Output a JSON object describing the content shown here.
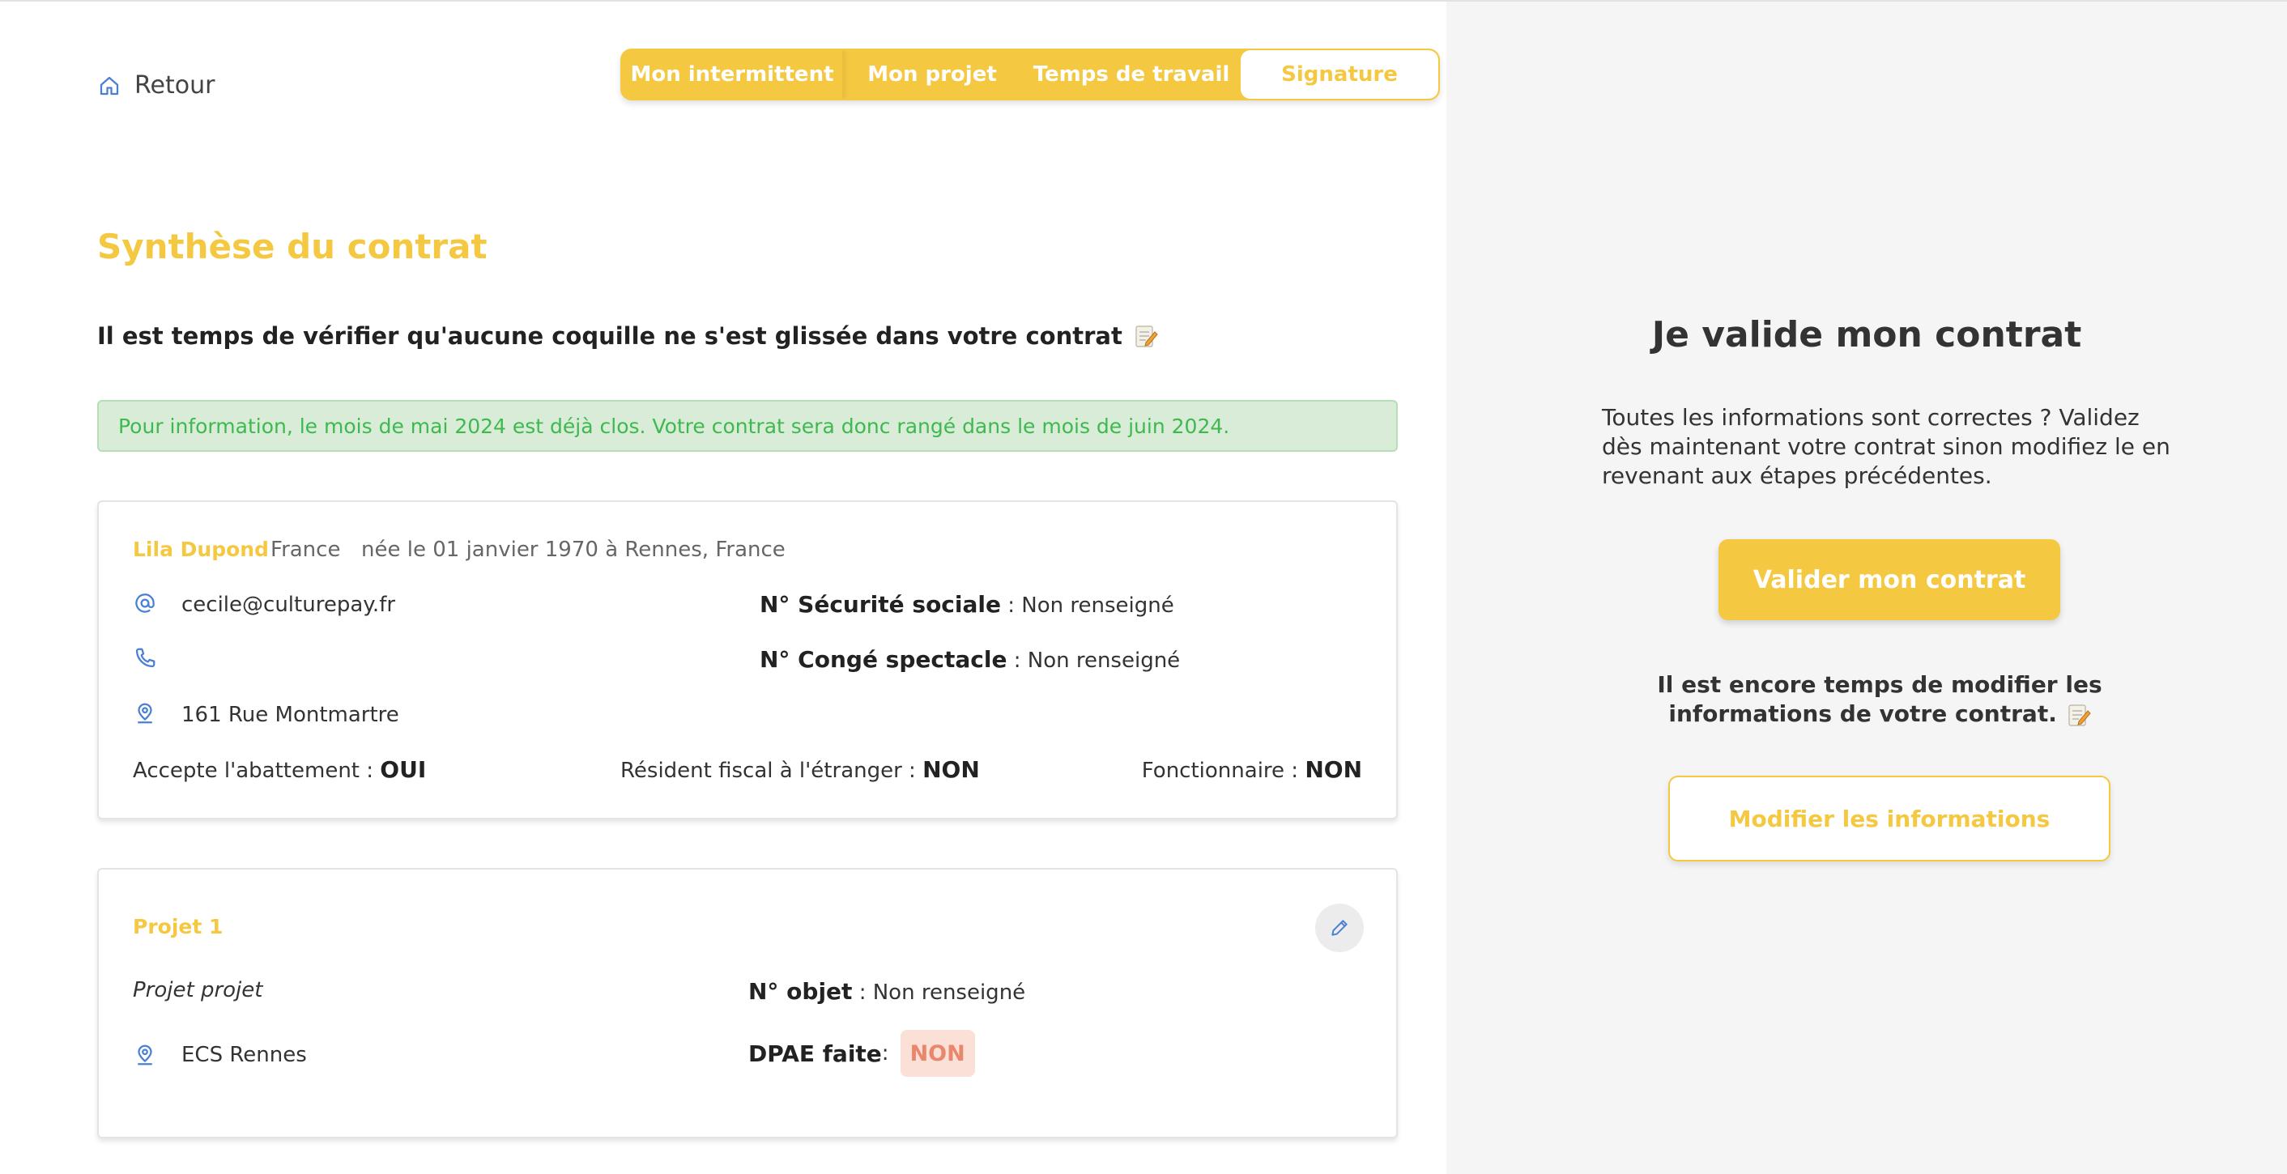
{
  "nav": {
    "back_label": "Retour",
    "steps": [
      "Mon intermittent",
      "Mon projet",
      "Temps de travail",
      "Signature"
    ],
    "active_step": "Signature"
  },
  "main": {
    "title": "Synthèse du contrat",
    "subtitle": "Il est temps de vérifier qu'aucune coquille ne s'est glissée dans votre contrat",
    "info_banner": "Pour information, le mois de mai 2024 est déjà clos. Votre contrat sera donc rangé dans le mois de juin 2024."
  },
  "person": {
    "name": "Lila Dupond",
    "country": "France",
    "birth": "née le 01 janvier 1970 à Rennes, France",
    "email": "cecile@culturepay.fr",
    "phone": "",
    "address": "161 Rue Montmartre",
    "secu_label": "N° Sécurité sociale",
    "secu_value": " : Non renseigné",
    "conge_label": "N° Congé spectacle",
    "conge_value": " : Non renseigné",
    "abattement_label": "Accepte l'abattement : ",
    "abattement_value": "OUI",
    "resident_label": "Résident fiscal à l'étranger : ",
    "resident_value": "NON",
    "fonctionnaire_label": "Fonctionnaire : ",
    "fonctionnaire_value": "NON"
  },
  "project": {
    "title": "Projet 1",
    "name": "Projet projet",
    "location": "ECS Rennes",
    "objet_label": "N° objet",
    "objet_value": " : Non renseigné",
    "dpae_label": "DPAE faite",
    "dpae_sep": " : ",
    "dpae_value": "NON"
  },
  "sidebar": {
    "title": "Je valide mon contrat",
    "text": "Toutes les informations sont correctes ? Validez dès maintenant votre contrat sinon modifiez le en revenant aux étapes précédentes.",
    "validate_label": "Valider mon contrat",
    "text2": "Il est encore temps de modifier les informations de votre contrat.",
    "modify_label": "Modifier les informations"
  },
  "colors": {
    "accent": "#f5c842",
    "success_text": "#3fb94f",
    "success_bg": "#d8ecd8",
    "danger_bg": "#fbe0d8",
    "danger_text": "#e8876c",
    "icon_blue": "#4a7fd4"
  },
  "icons": [
    "home-icon",
    "at-icon",
    "phone-icon",
    "location-pin-icon",
    "pencil-icon",
    "memo-icon"
  ]
}
